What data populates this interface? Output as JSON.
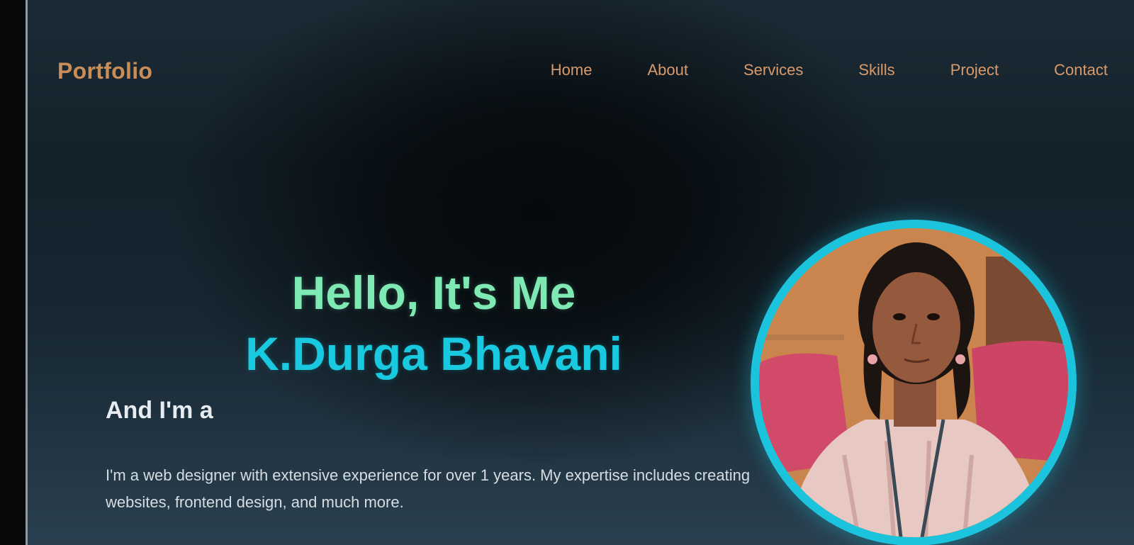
{
  "header": {
    "logo": "Portfolio",
    "nav": [
      {
        "label": "Home"
      },
      {
        "label": "About"
      },
      {
        "label": "Services"
      },
      {
        "label": "Skills"
      },
      {
        "label": "Project"
      },
      {
        "label": "Contact"
      }
    ]
  },
  "hero": {
    "greeting": "Hello, It's Me",
    "name": "K.Durga Bhavani",
    "role_prefix": "And I'm a",
    "description": "I'm a web designer with extensive experience for over 1 years. My expertise includes creating websites, frontend design, and much more."
  },
  "colors": {
    "logo": "#c98d5a",
    "nav": "#d99a6c",
    "greeting": "#7ee9b2",
    "name": "#19c9e0",
    "ring": "#1bc3dc"
  },
  "icons": [
    "profile-photo"
  ]
}
